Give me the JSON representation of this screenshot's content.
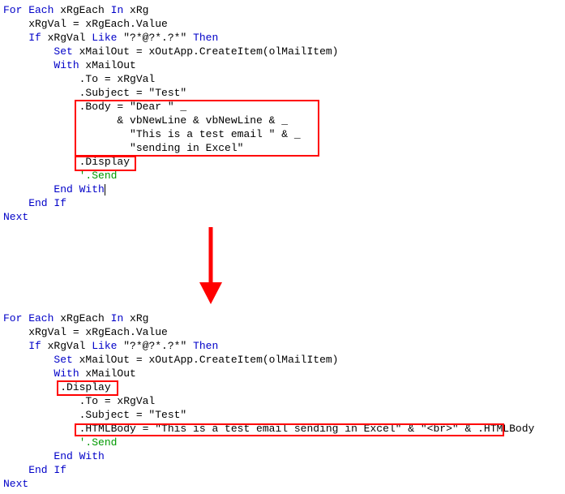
{
  "block1": {
    "l1a": "For Each",
    "l1b": " xRgEach ",
    "l1c": "In",
    "l1d": " xRg",
    "l2": "    xRgVal = xRgEach.Value",
    "l3a": "    If",
    "l3b": " xRgVal ",
    "l3c": "Like",
    "l3d": " \"?*@?*.?*\" ",
    "l3e": "Then",
    "l4a": "        Set",
    "l4b": " xMailOut = xOutApp.CreateItem(olMailItem)",
    "l5a": "        With",
    "l5b": " xMailOut",
    "l6": "            .To = xRgVal",
    "l7": "            .Subject = \"Test\"",
    "l8": "            .Body = \"Dear \" _",
    "l9": "                  & vbNewLine & vbNewLine & _",
    "l10": "                    \"This is a test email \" & _",
    "l11": "                    \"sending in Excel\"",
    "l12": "            .Display",
    "l13": "            '.Send",
    "l14a": "        End With",
    "l15": "    End If",
    "l16": "Next"
  },
  "block2": {
    "l1a": "For Each",
    "l1b": " xRgEach ",
    "l1c": "In",
    "l1d": " xRg",
    "l2": "    xRgVal = xRgEach.Value",
    "l3a": "    If",
    "l3b": " xRgVal ",
    "l3c": "Like",
    "l3d": " \"?*@?*.?*\" ",
    "l3e": "Then",
    "l4a": "        Set",
    "l4b": " xMailOut = xOutApp.CreateItem(olMailItem)",
    "l5a": "        With",
    "l5b": " xMailOut",
    "l6": "         .Display",
    "l7": "            .To = xRgVal",
    "l8": "            .Subject = \"Test\"",
    "l9": "            .HTMLBody = \"This is a test email sending in Excel\" & \"<br>\" & .HTMLBody",
    "l10": "            '.Send",
    "l11a": "        End With",
    "l12": "    End If",
    "l13": "Next"
  }
}
